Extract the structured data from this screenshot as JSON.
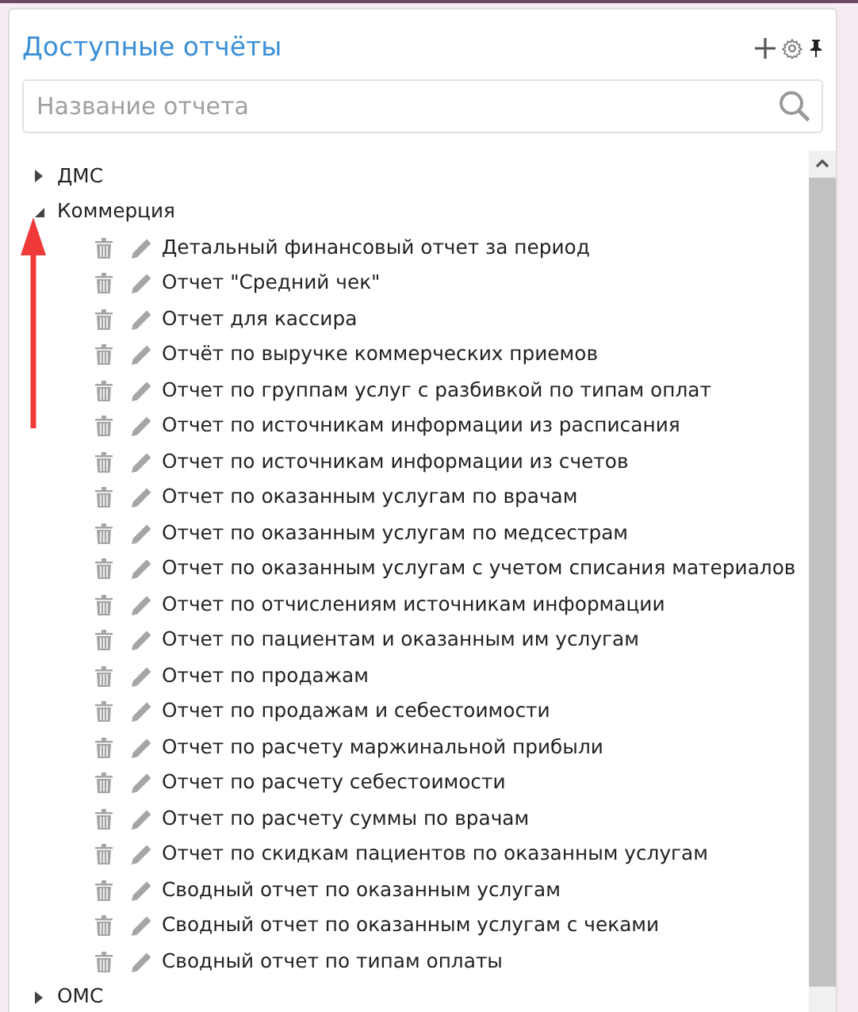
{
  "panel": {
    "title": "Доступные отчёты"
  },
  "search": {
    "placeholder": "Название отчета"
  },
  "tree": [
    {
      "label": "ДМС",
      "expanded": false
    },
    {
      "label": "Коммерция",
      "expanded": true,
      "children": [
        {
          "label": "Детальный финансовый отчет за период"
        },
        {
          "label": "Отчет \"Средний чек\""
        },
        {
          "label": "Отчет для кассира"
        },
        {
          "label": "Отчёт по выручке коммерческих приемов"
        },
        {
          "label": "Отчет по группам услуг с разбивкой по типам оплат"
        },
        {
          "label": "Отчет по источникам информации из расписания"
        },
        {
          "label": "Отчет по источникам информации из счетов"
        },
        {
          "label": "Отчет по оказанным услугам по врачам"
        },
        {
          "label": "Отчет по оказанным услугам по медсестрам"
        },
        {
          "label": "Отчет по оказанным услугам с учетом списания материалов"
        },
        {
          "label": "Отчет по отчислениям источникам информации"
        },
        {
          "label": "Отчет по пациентам и оказанным им услугам"
        },
        {
          "label": "Отчет по продажам"
        },
        {
          "label": "Отчет по продажам и себестоимости"
        },
        {
          "label": "Отчет по расчету маржинальной прибыли"
        },
        {
          "label": "Отчет по расчету себестоимости"
        },
        {
          "label": "Отчет по расчету суммы по врачам"
        },
        {
          "label": "Отчет по скидкам пациентов по оказанным услугам"
        },
        {
          "label": "Сводный отчет по оказанным услугам"
        },
        {
          "label": "Сводный отчет по оказанным услугам с чеками"
        },
        {
          "label": "Сводный отчет по типам оплаты"
        }
      ]
    },
    {
      "label": "ОМС",
      "expanded": false
    }
  ]
}
